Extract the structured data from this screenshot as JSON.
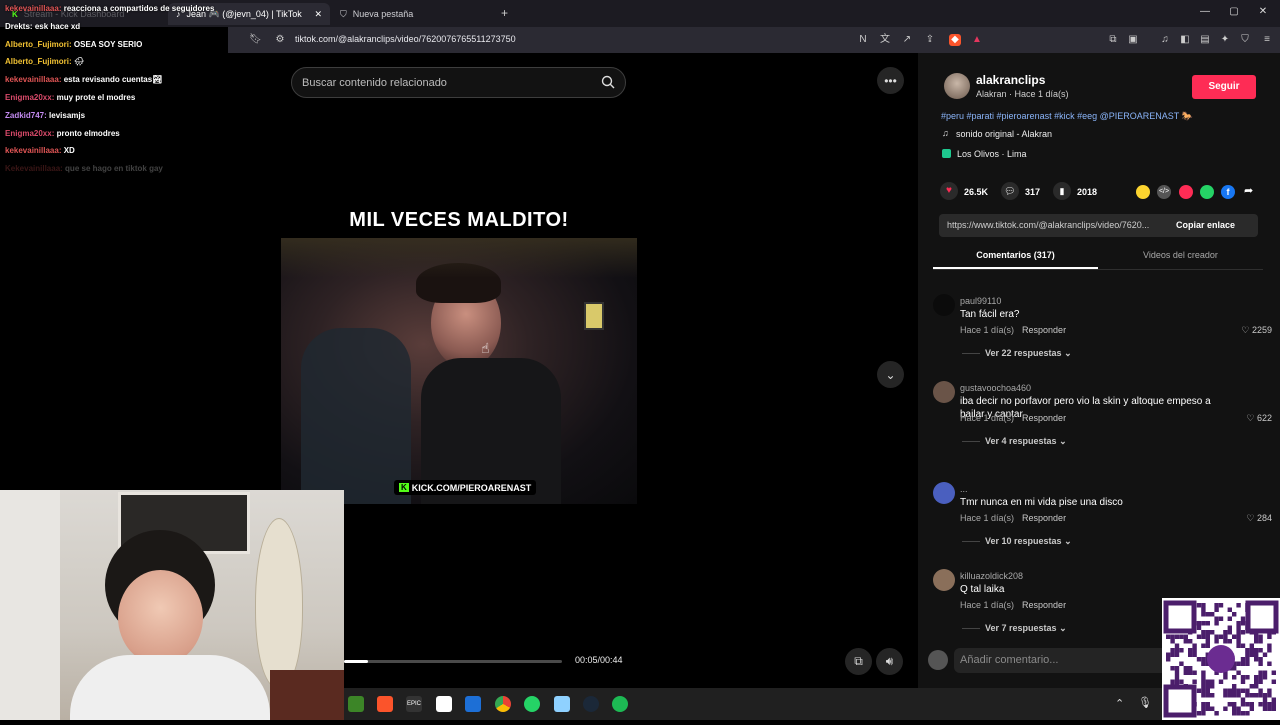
{
  "browser": {
    "tabs": [
      {
        "label": "Stream - Kick Dashboard"
      },
      {
        "label": "Jean 🎮 (@jevn_04) | TikTok"
      },
      {
        "label": "Nueva pestaña"
      }
    ],
    "url": "tiktok.com/@alakranclips/video/7620076765511273750"
  },
  "chat": {
    "messages": [
      {
        "user": "kekevainillaaa:",
        "text": "reacciona a compartidos de seguidores",
        "color": "#e05555"
      },
      {
        "user": "Drekts:",
        "text": "esk hace xd",
        "color": "#ffffff"
      },
      {
        "user": "Alberto_Fujimori:",
        "text": "OSEA SOY SERIO",
        "color": "#f2c233"
      },
      {
        "user": "Alberto_Fujimori:",
        "text": "🌧",
        "color": "#f2c233"
      },
      {
        "user": "kekevainillaaa:",
        "text": "esta revisando cuentas🏞",
        "color": "#e05555"
      },
      {
        "user": "Enigma20xx:",
        "text": "muy prote el modres",
        "color": "#d94a6a"
      },
      {
        "user": "Zadkid747:",
        "text": "levisamjs",
        "color": "#c38bf0"
      },
      {
        "user": "Enigma20xx:",
        "text": "pronto elmodres",
        "color": "#d94a6a"
      },
      {
        "user": "kekevainillaaa:",
        "text": "XD",
        "color": "#e05555"
      },
      {
        "user": "Kekevainillaaa:",
        "text": "que se hago en tiktok gay",
        "color": "#e05555"
      }
    ]
  },
  "video": {
    "search_placeholder": "Buscar contenido relacionado",
    "caption": "MIL VECES MALDITO!",
    "kick_tag": "KICK.COM/PIEROARENAST",
    "time": "00:05/00:44",
    "progress": 0.11
  },
  "creator": {
    "username": "alakranclips",
    "subline": "Alakran · Hace 1 día(s)",
    "follow_label": "Seguir",
    "hashtags": "#peru #parati #pieroarenast #kick #eeg @PIEROARENAST 🐎",
    "sound": "sonido original - Alakran",
    "location": "Los Olivos · Lima",
    "likes": "26.5K",
    "comments": "317",
    "saves": "2018",
    "link": "https://www.tiktok.com/@alakranclips/video/7620...",
    "copy_label": "Copiar enlace"
  },
  "tabs": {
    "comments": "Comentarios (317)",
    "creator_videos": "Videos del creador"
  },
  "comments": [
    {
      "user": "paul99110",
      "text": "Tan fácil era?",
      "time": "Hace 1 día(s)",
      "reply": "Responder",
      "likes": "2259",
      "replies": "Ver 22 respuestas",
      "avatar": "#0b0b0b"
    },
    {
      "user": "gustavoochoa460",
      "text": "iba decir no porfavor pero vio la skin y altoque empeso a bailar y cantar",
      "time": "Hace 1 día(s)",
      "reply": "Responder",
      "likes": "622",
      "replies": "Ver 4 respuestas",
      "avatar": "#6a5448"
    },
    {
      "user": "...",
      "text": "Tmr nunca en mi vida pise una disco",
      "time": "Hace 1 día(s)",
      "reply": "Responder",
      "likes": "284",
      "replies": "Ver 10 respuestas",
      "avatar": "#4a5fbf"
    },
    {
      "user": "killuazoldick208",
      "text": "Q tal laika",
      "time": "Hace 1 día(s)",
      "reply": "Responder",
      "likes": "",
      "replies": "Ver 7 respuestas",
      "avatar": "#8a6f5a"
    }
  ],
  "add_comment_placeholder": "Añadir comentario...",
  "colors": {
    "accent": "#fe2c55",
    "kick_green": "#53fc18"
  }
}
